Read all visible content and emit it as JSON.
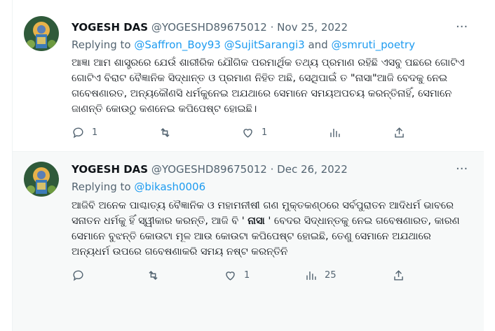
{
  "tweets": [
    {
      "name": "YOGESH DAS",
      "handle": "@YOGESHD89675012",
      "dot": "·",
      "date": "Nov 25, 2022",
      "replying_prefix": "Replying to ",
      "mentions": [
        "@Saffron_Boy93",
        "@SujitSarangi3",
        "@smruti_poetry"
      ],
      "and": " and ",
      "text": "ଆଜ୍ଞା ଆମ ଶାସ୍ତ୍ରରେ ଯେଉଁ ଶାରୀରିକ ଯୌଗିକ ପରମାର୍ଥିକ ତଥ୍ୟ ପ୍ରମାଣ ରହିଛି ଏସବୁ ପଛରେ ଗୋଟିଏ ଗୋଟିଏ ବିରାଟ ବୈଜ୍ଞାନିକ ସିଦ୍ଧାନ୍ତ ଓ ପ୍ରମାଣ ନିହିତ ଅଛି, ସେଥିପାଇଁ ତ \"ନାସା\"ଆଜି ବେଦକୁ ନେଇ ଗବେଷଣାରତ, ଅନ୍ୟକୌଣସି ଧର୍ମକୁନେଇ ଅଯଥାରେ ସେମାନେ ସମୟଅପଚୟ କରନ୍ତିନାହିଁ, ସେମାନେ ଜାଣନ୍ତି କୋଉଠୁ କଣନେଇ କପିପେଷ୍ଟ ହୋଇଛି।",
      "reply_count": "1",
      "retweet_count": "",
      "like_count": "1",
      "views_count": ""
    },
    {
      "name": "YOGESH DAS",
      "handle": "@YOGESHD89675012",
      "dot": "·",
      "date": "Dec 26, 2022",
      "replying_prefix": "Replying to ",
      "mentions": [
        "@bikash0006"
      ],
      "text_a": "ଆଜିବି ଅନେକ ପାଶ୍ଚାତ୍ୟ ବୈଜ୍ଞାନିକ ଓ ମହାମନୀଷୀ ଗଣ ମୁକ୍ତକଣ୍ଠରେ ସର୍ବପୁରାତନ ଆଦିଧର୍ମ ଭାବରେ ସନାତନ ଧର୍ମକୁ ହିଁ ସ୍ୱୀକାର କରନ୍ତି, ଆଜି ବି ' ",
      "text_bold": "ନାସା",
      "text_b": " ' ବେଦର ସିଦ୍ଧାନ୍ତକୁ ନେଇ ଗବେଷଣାରତ, କାରଣ ସେମାନେ ବୁଝନ୍ତି କୋଉଟା ମୂଳ ଆଉ କୋଉଟା କପିପେଷ୍ଟ ହୋଇଛି, ତେଣୁ ସେମାନେ ଅଯଥାରେ ଅନ୍ୟଧର୍ମ ଉପରେ ଗବେଷଣାକରି ସମୟ ନଷ୍ଟ କରନ୍ତିନି",
      "reply_count": "",
      "retweet_count": "",
      "like_count": "1",
      "views_count": "25"
    }
  ],
  "more_label": "···",
  "colors": {
    "accent": "#1d9bf0",
    "muted": "#536471",
    "text": "#0f1419",
    "hover_bg": "#f7f9f9"
  }
}
